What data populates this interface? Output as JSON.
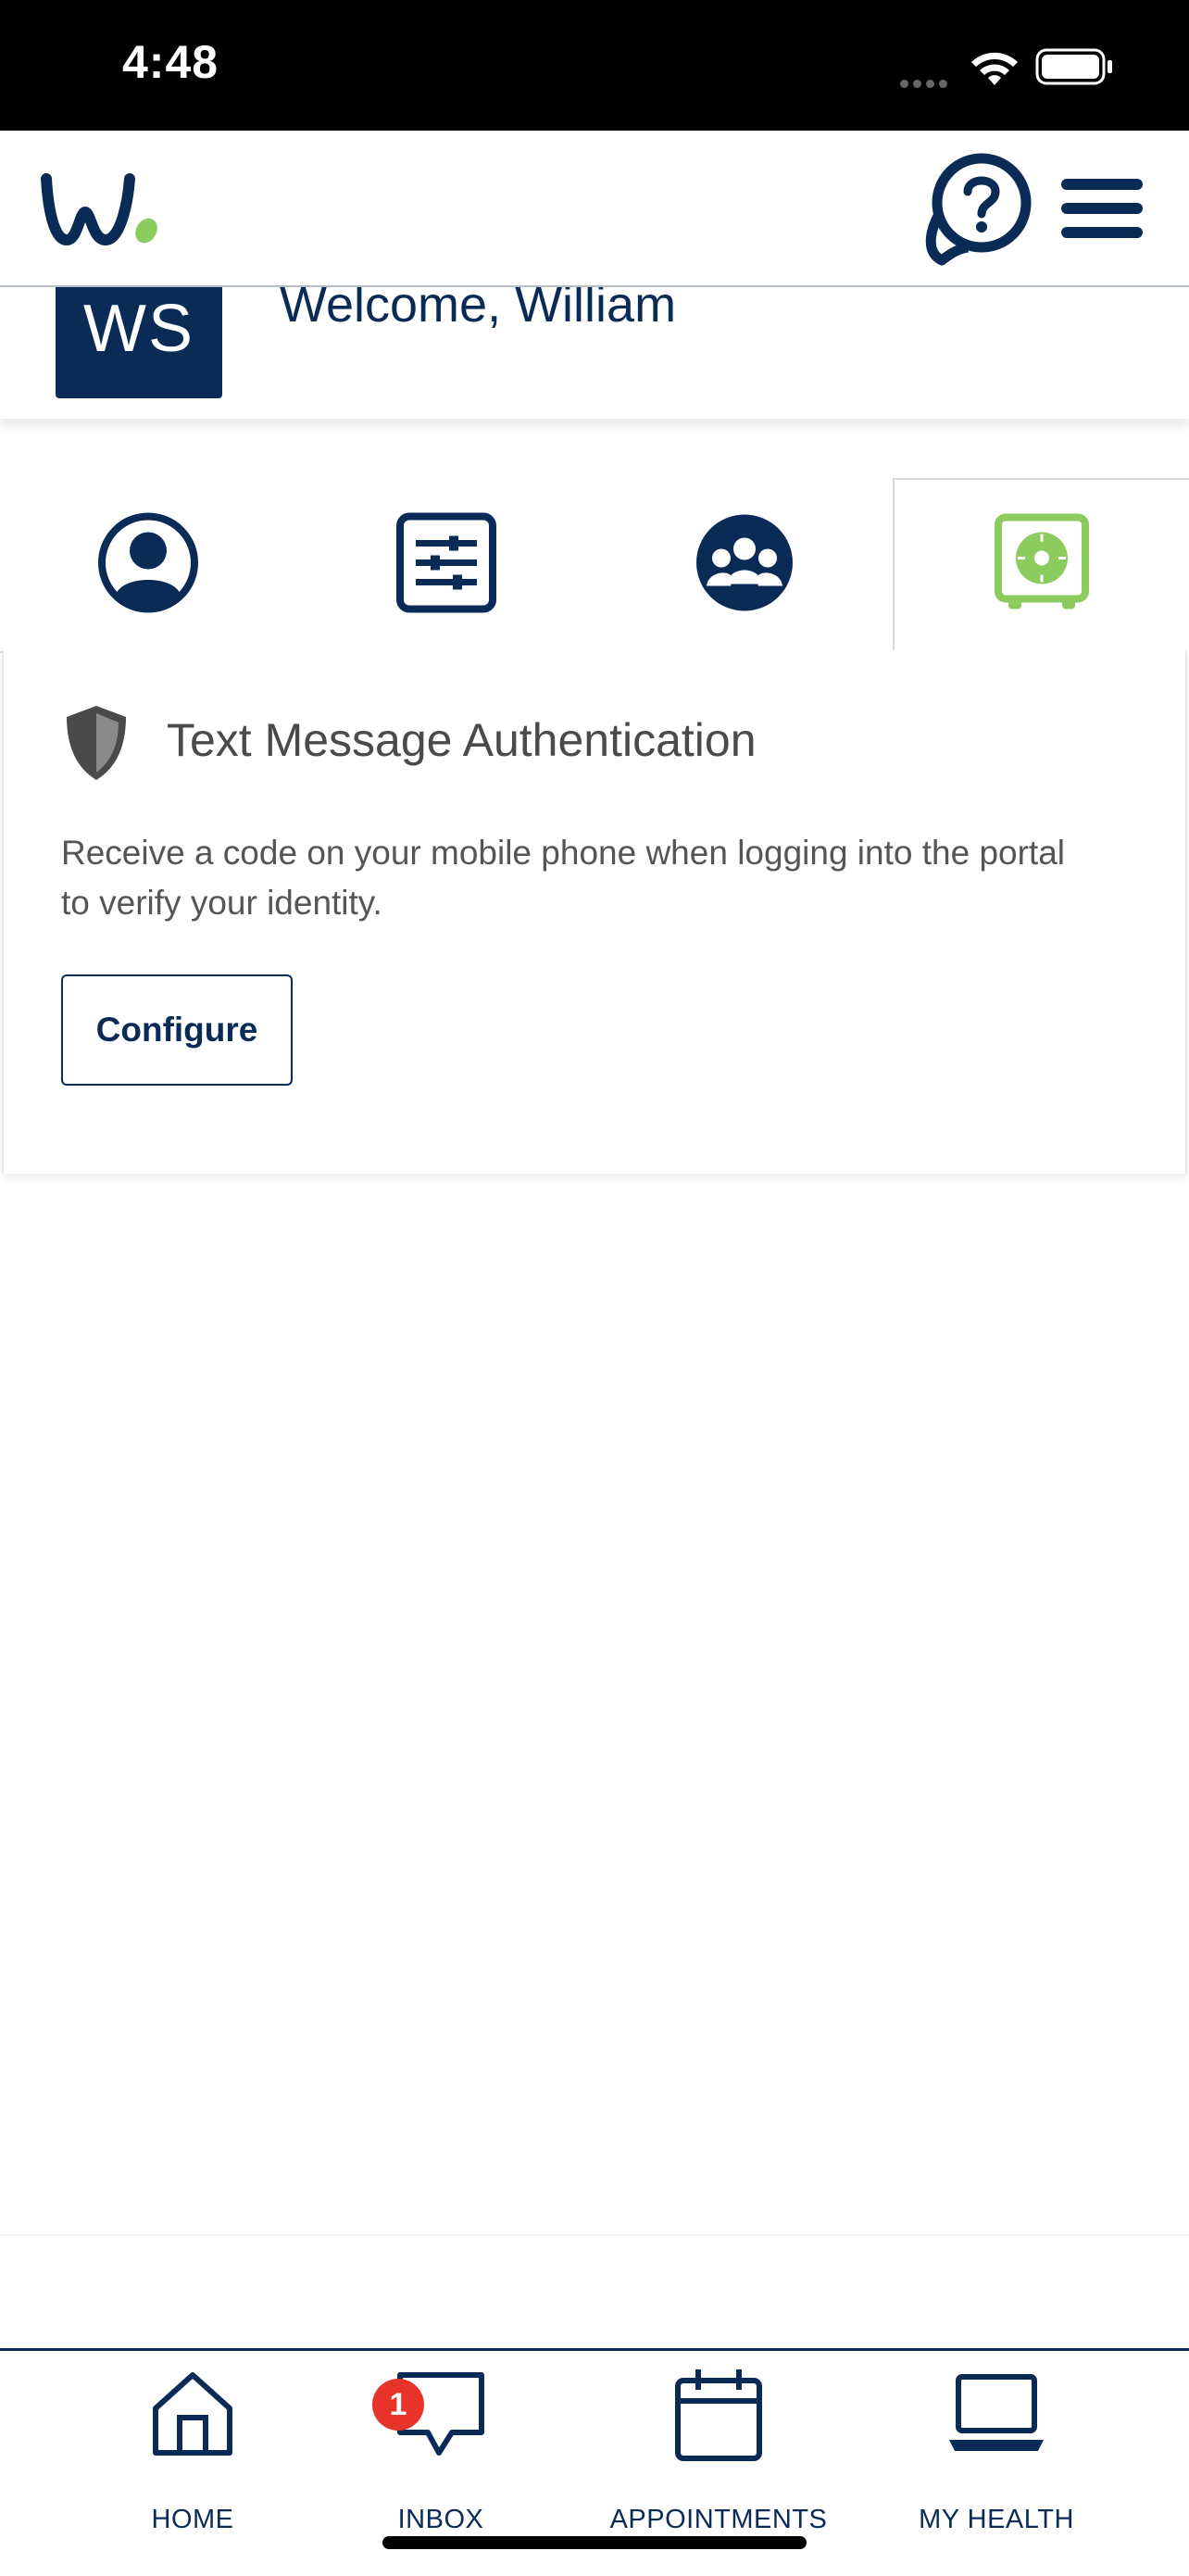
{
  "status_bar": {
    "time": "4:48"
  },
  "header": {
    "logo_icon": "wellness-w-logo",
    "help_icon": "help-chat-icon",
    "menu_icon": "hamburger-menu-icon"
  },
  "welcome": {
    "initials": "WS",
    "text": "Welcome, William"
  },
  "tabs": [
    {
      "icon": "profile-icon",
      "active": false
    },
    {
      "icon": "settings-sliders-icon",
      "active": false
    },
    {
      "icon": "group-icon",
      "active": false
    },
    {
      "icon": "safe-lock-icon",
      "active": true
    }
  ],
  "card": {
    "icon": "shield-icon",
    "title": "Text Message Authentication",
    "description": "Receive a code on your mobile phone when logging into the portal to verify your identity.",
    "button_label": "Configure"
  },
  "bottom_nav": {
    "items": [
      {
        "label": "HOME",
        "icon": "home-icon"
      },
      {
        "label": "INBOX",
        "icon": "inbox-chat-icon",
        "badge": "1"
      },
      {
        "label": "APPOINTMENTS",
        "icon": "calendar-icon"
      },
      {
        "label": "MY HEALTH",
        "icon": "laptop-icon"
      }
    ]
  },
  "colors": {
    "navy": "#0b2b57",
    "green": "#8ccb5e",
    "badge_red": "#e8332a"
  }
}
